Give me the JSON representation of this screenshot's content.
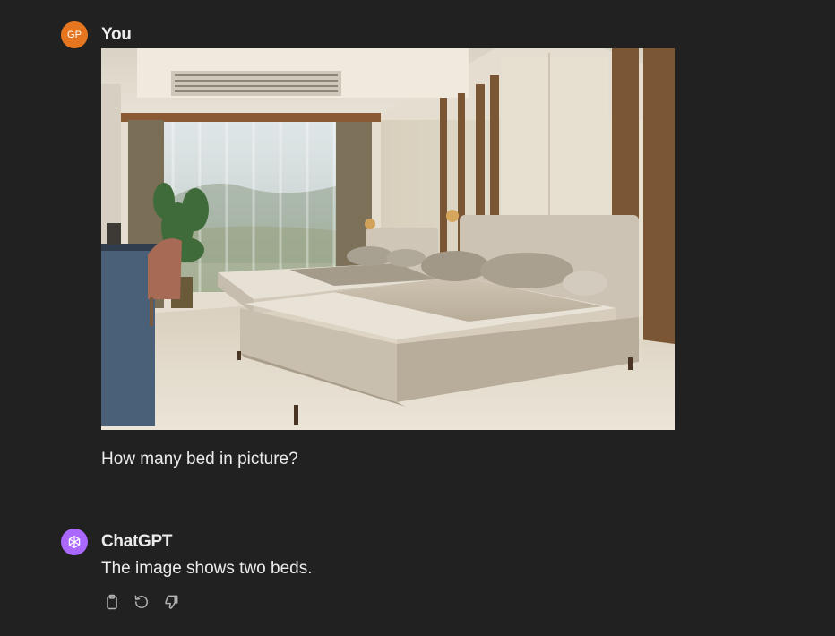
{
  "user_message": {
    "avatar_initials": "GP",
    "author": "You",
    "text": "How many bed in picture?",
    "image_icon": "hotel-room-photo"
  },
  "assistant_message": {
    "author": "ChatGPT",
    "text": "The image shows two beds.",
    "avatar_icon": "openai-logo-icon",
    "actions": [
      "copy-icon",
      "regenerate-icon",
      "thumbs-down-icon"
    ]
  },
  "colors": {
    "background": "#212121",
    "text": "#ececec",
    "user_avatar": "#e5761f",
    "assistant_avatar": "#ab68ff",
    "icon": "#b4b4b4"
  }
}
